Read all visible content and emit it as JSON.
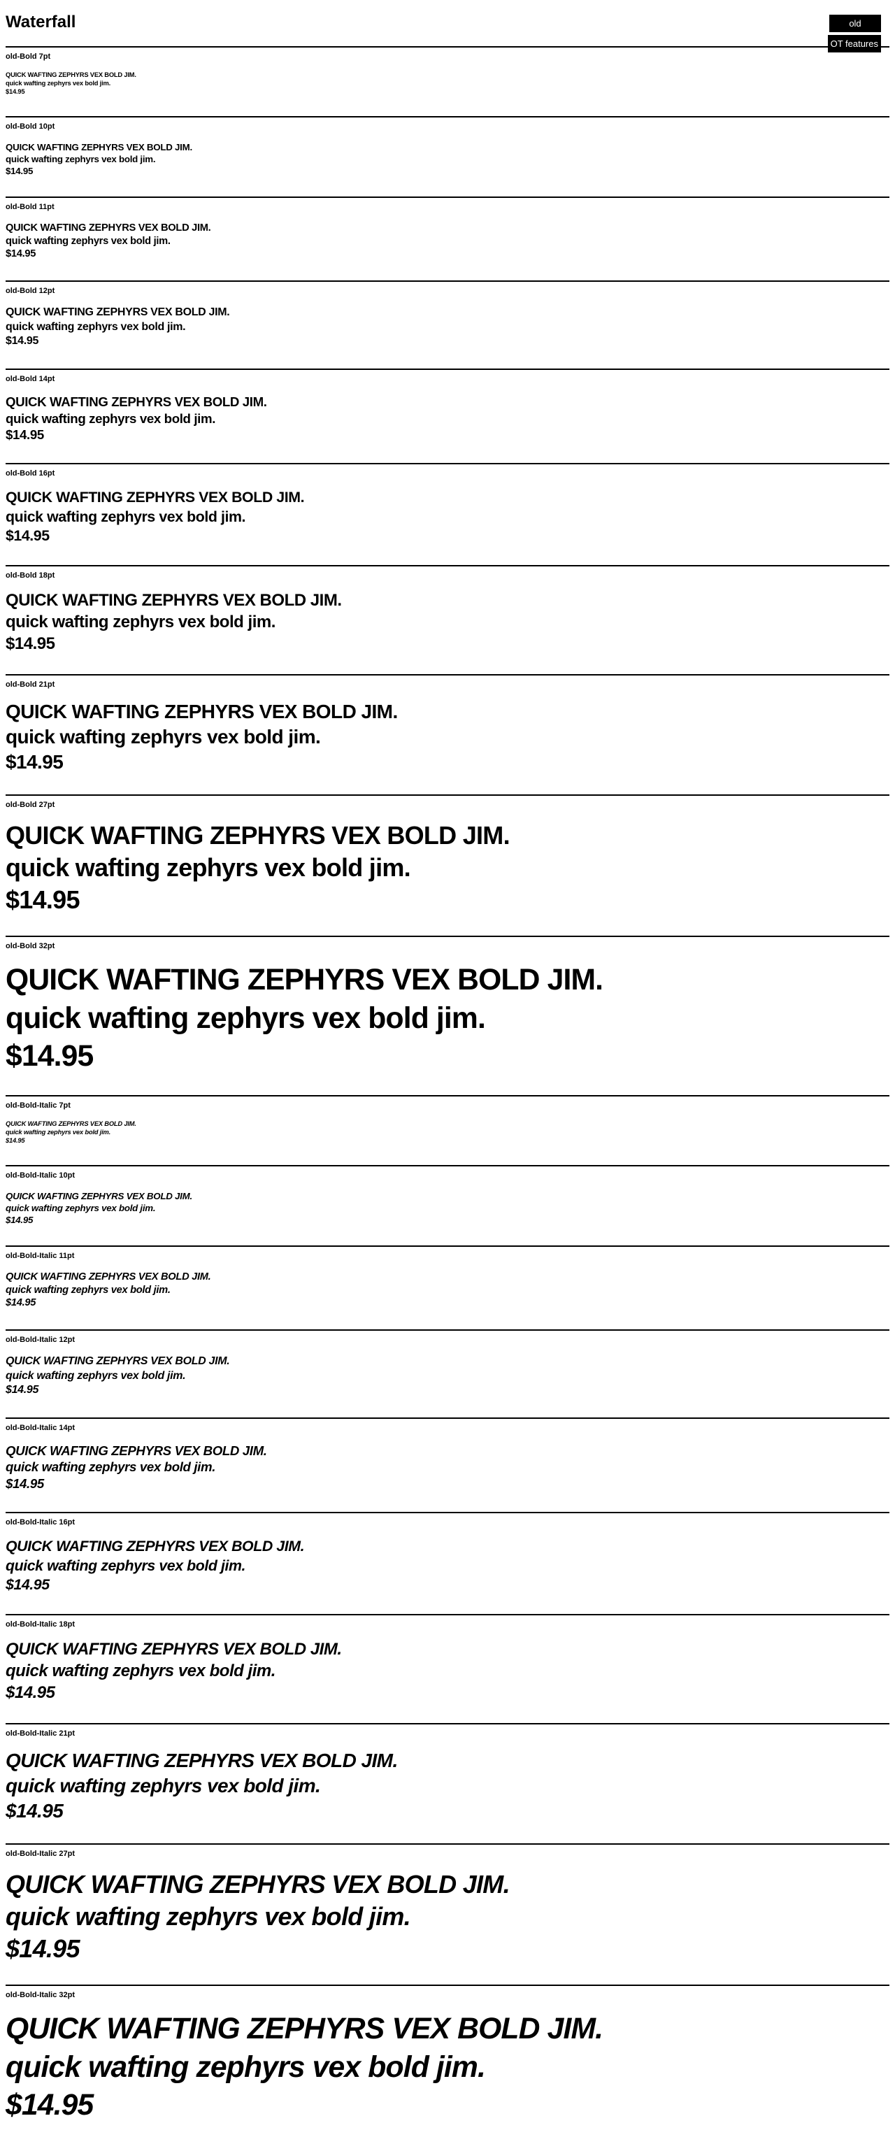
{
  "header": {
    "title": "Waterfall"
  },
  "controls": {
    "font_button": "old",
    "ot_button": "OT features"
  },
  "sample_lines": [
    "QUICK WAFTING ZEPHYRS VEX BOLD JIM.",
    "quick wafting zephyrs vex bold jim.",
    "$14.95"
  ],
  "sections": [
    {
      "label": "old-Bold 7pt",
      "pt": 7,
      "italic": false
    },
    {
      "label": "old-Bold 10pt",
      "pt": 10,
      "italic": false
    },
    {
      "label": "old-Bold 11pt",
      "pt": 11,
      "italic": false
    },
    {
      "label": "old-Bold 12pt",
      "pt": 12,
      "italic": false
    },
    {
      "label": "old-Bold 14pt",
      "pt": 14,
      "italic": false
    },
    {
      "label": "old-Bold 16pt",
      "pt": 16,
      "italic": false
    },
    {
      "label": "old-Bold 18pt",
      "pt": 18,
      "italic": false
    },
    {
      "label": "old-Bold 21pt",
      "pt": 21,
      "italic": false
    },
    {
      "label": "old-Bold 27pt",
      "pt": 27,
      "italic": false
    },
    {
      "label": "old-Bold 32pt",
      "pt": 32,
      "italic": false
    },
    {
      "label": "old-Bold-Italic 7pt",
      "pt": 7,
      "italic": true
    },
    {
      "label": "old-Bold-Italic 10pt",
      "pt": 10,
      "italic": true
    },
    {
      "label": "old-Bold-Italic 11pt",
      "pt": 11,
      "italic": true
    },
    {
      "label": "old-Bold-Italic 12pt",
      "pt": 12,
      "italic": true
    },
    {
      "label": "old-Bold-Italic 14pt",
      "pt": 14,
      "italic": true
    },
    {
      "label": "old-Bold-Italic 16pt",
      "pt": 16,
      "italic": true
    },
    {
      "label": "old-Bold-Italic 18pt",
      "pt": 18,
      "italic": true
    },
    {
      "label": "old-Bold-Italic 21pt",
      "pt": 21,
      "italic": true
    },
    {
      "label": "old-Bold-Italic 27pt",
      "pt": 27,
      "italic": true
    },
    {
      "label": "old-Bold-Italic 32pt",
      "pt": 32,
      "italic": true
    }
  ]
}
